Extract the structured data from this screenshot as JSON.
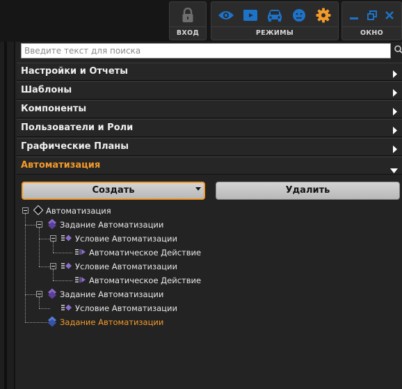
{
  "toolbar": {
    "login_caption": "ВХОД",
    "modes_caption": "РЕЖИМЫ",
    "window_caption": "ОКНО",
    "colors": {
      "accent": "#f39a2a",
      "mode_icon": "#1d73c9"
    }
  },
  "search": {
    "placeholder": "Введите текст для поиска",
    "value": ""
  },
  "sections": [
    {
      "label": "Настройки и Отчеты",
      "state": "collapsed"
    },
    {
      "label": "Шаблоны",
      "state": "collapsed"
    },
    {
      "label": "Компоненты",
      "state": "collapsed"
    },
    {
      "label": "Пользователи и Роли",
      "state": "collapsed"
    },
    {
      "label": "Графические Планы",
      "state": "collapsed"
    },
    {
      "label": "Автоматизация",
      "state": "expanded"
    }
  ],
  "actions": {
    "create_label": "Создать",
    "delete_label": "Удалить"
  },
  "tree": [
    {
      "label": "Автоматизация",
      "level": 0,
      "icon": "automation-root-icon"
    },
    {
      "label": "Задание Автоматизации",
      "level": 1,
      "icon": "task-icon"
    },
    {
      "label": "Условие Автоматизации",
      "level": 2,
      "icon": "condition-icon"
    },
    {
      "label": "Автоматическое Действие",
      "level": 3,
      "icon": "action-icon"
    },
    {
      "label": "Условие Автоматизации",
      "level": 2,
      "icon": "condition-icon"
    },
    {
      "label": "Автоматическое Действие",
      "level": 3,
      "icon": "action-icon"
    },
    {
      "label": "Задание Автоматизации",
      "level": 1,
      "icon": "task-icon"
    },
    {
      "label": "Условие Автоматизации",
      "level": 2,
      "icon": "condition-icon"
    },
    {
      "label": "Задание Автоматизации",
      "level": 1,
      "icon": "task-icon-new",
      "selected": true
    }
  ]
}
